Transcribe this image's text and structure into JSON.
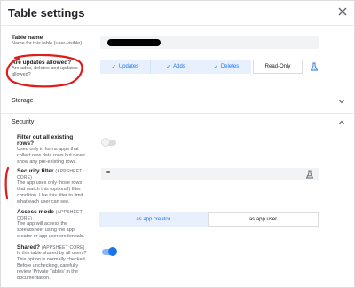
{
  "dialog": {
    "title": "Table settings"
  },
  "table_name": {
    "label": "Table name",
    "hint": "Name for this table (user-visible)"
  },
  "updates": {
    "label": "Are updates allowed?",
    "hint": "Are adds, deletes and updates allowed?",
    "options": [
      "Updates",
      "Adds",
      "Deletes"
    ],
    "readonly_label": "Read-Only"
  },
  "sections": {
    "storage": "Storage",
    "security": "Security"
  },
  "filter_rows": {
    "label": "Filter out all existing rows?",
    "hint": "Used only in forms apps that collect new data rows but never show any pre-existing rows.",
    "enabled": false
  },
  "security_filter": {
    "label": "Security filter",
    "tag": "(APPSHEET CORE)",
    "hint": "The app uses only those rows that match this (optional) filter condition. Use this filter to limit what each user can see.",
    "value": "="
  },
  "access_mode": {
    "label": "Access mode",
    "tag": "(APPSHEET CORE)",
    "hint": "The app will access the spreadsheet using the app creator or app user credentials.",
    "options": [
      "as app creator",
      "as app user"
    ],
    "selected": "as app creator"
  },
  "shared": {
    "label": "Shared?",
    "tag": "(APPSHEET CORE)",
    "hint": "Is this table shared by all users? This option is normally checked. Before unchecking, carefully review 'Private Tables' in the documentation.",
    "enabled": true
  },
  "colors": {
    "accent": "#1a73e8",
    "accent_light": "#e8f0fe",
    "annotation_red": "#e01b1b"
  },
  "icons": [
    "close-icon",
    "check-icon",
    "flask-icon",
    "chevron-down-icon",
    "chevron-up-icon"
  ]
}
